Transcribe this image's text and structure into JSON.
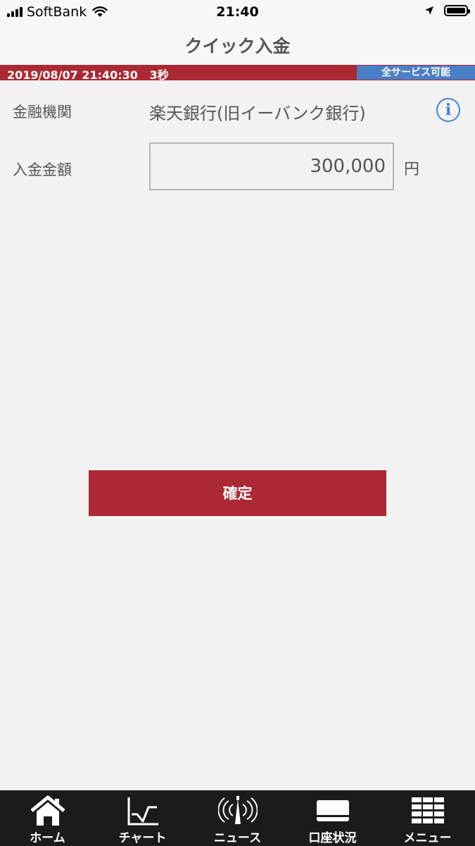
{
  "status_bar": {
    "carrier": "SoftBank",
    "time": "21:40",
    "battery_level": 1.0
  },
  "header": {
    "title": "クイック入金"
  },
  "info_strip": {
    "datetime": "2019/08/07 21:40:30",
    "interval": "3秒",
    "service_status": "全サービス可能",
    "colors": {
      "strip": "#ab2934",
      "status": "#4a7fc6"
    }
  },
  "form": {
    "institution_label": "金融機関",
    "institution_value": "楽天銀行(旧イーバンク銀行)",
    "amount_label": "入金金額",
    "amount_value": "300,000",
    "amount_unit": "円",
    "info_icon_glyph": "i"
  },
  "confirm": {
    "label": "確定",
    "color": "#ab2934"
  },
  "tabbar": {
    "tabs": [
      {
        "label": "ホーム",
        "icon": "home-icon"
      },
      {
        "label": "チャート",
        "icon": "chart-icon"
      },
      {
        "label": "ニュース",
        "icon": "news-antenna-icon"
      },
      {
        "label": "口座状況",
        "icon": "card-icon"
      },
      {
        "label": "メニュー",
        "icon": "menu-grid-icon"
      }
    ]
  }
}
